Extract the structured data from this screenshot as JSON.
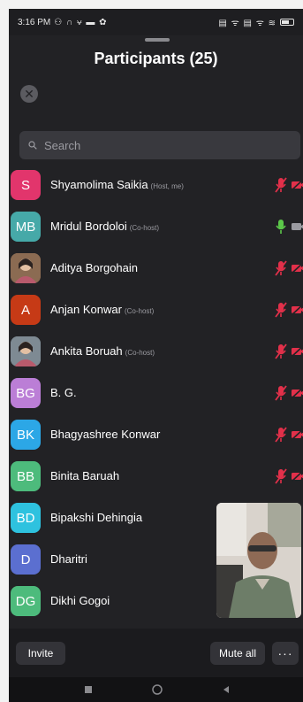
{
  "status_bar": {
    "time": "3:16 PM",
    "left_glyphs": "⚇ ∩ ⩝ ▬ ✿",
    "right_glyphs": "▤ ᯤ ▤ ᯤ ≋"
  },
  "header": {
    "title": "Participants (25)"
  },
  "search": {
    "placeholder": "Search"
  },
  "participants": [
    {
      "initials": "S",
      "name": "Shyamolima Saikia",
      "tag": "(Host, me)",
      "color": "#e2356c",
      "mic": "muted",
      "video": "off",
      "photo": false
    },
    {
      "initials": "MB",
      "name": "Mridul Bordoloi",
      "tag": "(Co-host)",
      "color": "#46a9a8",
      "mic": "on",
      "video": "on",
      "photo": false
    },
    {
      "initials": "",
      "name": "Aditya Borgohain",
      "tag": "",
      "color": "#8b6b52",
      "mic": "muted",
      "video": "off",
      "photo": true
    },
    {
      "initials": "A",
      "name": "Anjan Konwar",
      "tag": "(Co-host)",
      "color": "#c63a16",
      "mic": "muted",
      "video": "off",
      "photo": false
    },
    {
      "initials": "",
      "name": "Ankita Boruah",
      "tag": "(Co-host)",
      "color": "#7e8a93",
      "mic": "muted",
      "video": "off",
      "photo": true
    },
    {
      "initials": "BG",
      "name": "B. G.",
      "tag": "",
      "color": "#bb7ed6",
      "mic": "muted",
      "video": "off",
      "photo": false
    },
    {
      "initials": "BK",
      "name": "Bhagyashree Konwar",
      "tag": "",
      "color": "#2ca7e6",
      "mic": "muted",
      "video": "off",
      "photo": false
    },
    {
      "initials": "BB",
      "name": "Binita Baruah",
      "tag": "",
      "color": "#4dbb7c",
      "mic": "muted",
      "video": "off",
      "photo": false
    },
    {
      "initials": "BD",
      "name": "Bipakshi Dehingia",
      "tag": "",
      "color": "#2ec2df",
      "mic": "",
      "video": "",
      "photo": false
    },
    {
      "initials": "D",
      "name": "Dharitri",
      "tag": "",
      "color": "#5b6fd0",
      "mic": "",
      "video": "",
      "photo": false
    },
    {
      "initials": "DG",
      "name": "Dikhi Gogoi",
      "tag": "",
      "color": "#4dbb7c",
      "mic": "",
      "video": "",
      "photo": false
    }
  ],
  "bottom_bar": {
    "invite_label": "Invite",
    "mute_all_label": "Mute all",
    "more_label": "···"
  },
  "colors": {
    "muted_red": "#e2304a",
    "mic_on_green": "#5cc84a",
    "background": "#222225"
  }
}
